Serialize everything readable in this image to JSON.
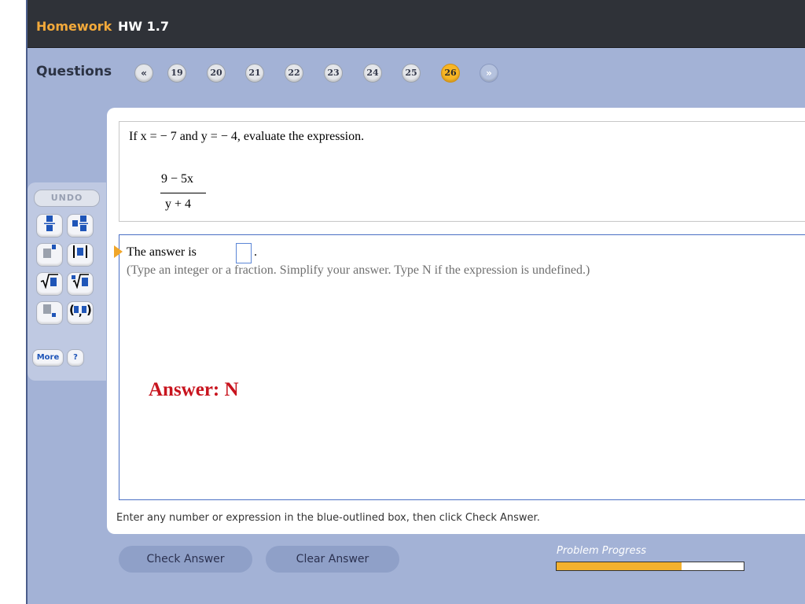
{
  "header": {
    "section": "Homework",
    "assignment": "HW 1.7"
  },
  "questions_nav": {
    "label": "Questions",
    "prev_icon": "«",
    "next_icon": "»",
    "items": [
      {
        "number": "19",
        "current": false
      },
      {
        "number": "20",
        "current": false
      },
      {
        "number": "21",
        "current": false
      },
      {
        "number": "22",
        "current": false
      },
      {
        "number": "23",
        "current": false
      },
      {
        "number": "24",
        "current": false
      },
      {
        "number": "25",
        "current": false
      },
      {
        "number": "26",
        "current": true
      }
    ]
  },
  "question": {
    "prompt": "If x = − 7 and y = − 4, evaluate the expression.",
    "numerator": "9 − 5x",
    "denominator": "y + 4"
  },
  "answer": {
    "prefix": "The answer is",
    "input_value": "",
    "suffix": ".",
    "instructions": "(Type an integer or a fraction.  Simplify your answer.  Type N if the expression is undefined.)",
    "annotation": "Answer: N"
  },
  "footer_note": "Enter any number or expression in the blue-outlined box, then click Check Answer.",
  "toolbar": {
    "undo_label": "UNDO",
    "more_label": "More",
    "help_label": "?",
    "buttons": [
      {
        "name": "fraction-icon",
        "glyph": "▭"
      },
      {
        "name": "mixed-number-icon",
        "glyph": "▭"
      },
      {
        "name": "exponent-icon",
        "glyph": "■'"
      },
      {
        "name": "absolute-value-icon",
        "glyph": "|■|"
      },
      {
        "name": "square-root-icon",
        "glyph": "√■"
      },
      {
        "name": "nth-root-icon",
        "glyph": "∛■"
      },
      {
        "name": "subscript-icon",
        "glyph": "■,"
      },
      {
        "name": "ordered-pair-icon",
        "glyph": "(■,■)"
      }
    ]
  },
  "actions": {
    "check_answer": "Check Answer",
    "clear_answer": "Clear Answer"
  },
  "progress": {
    "label": "Problem Progress",
    "fraction": 0.67
  },
  "colors": {
    "accent_orange": "#f8b625",
    "input_border": "#5b86d6",
    "answer_red": "#c8141e",
    "frame_blue": "#a3b2d6"
  }
}
